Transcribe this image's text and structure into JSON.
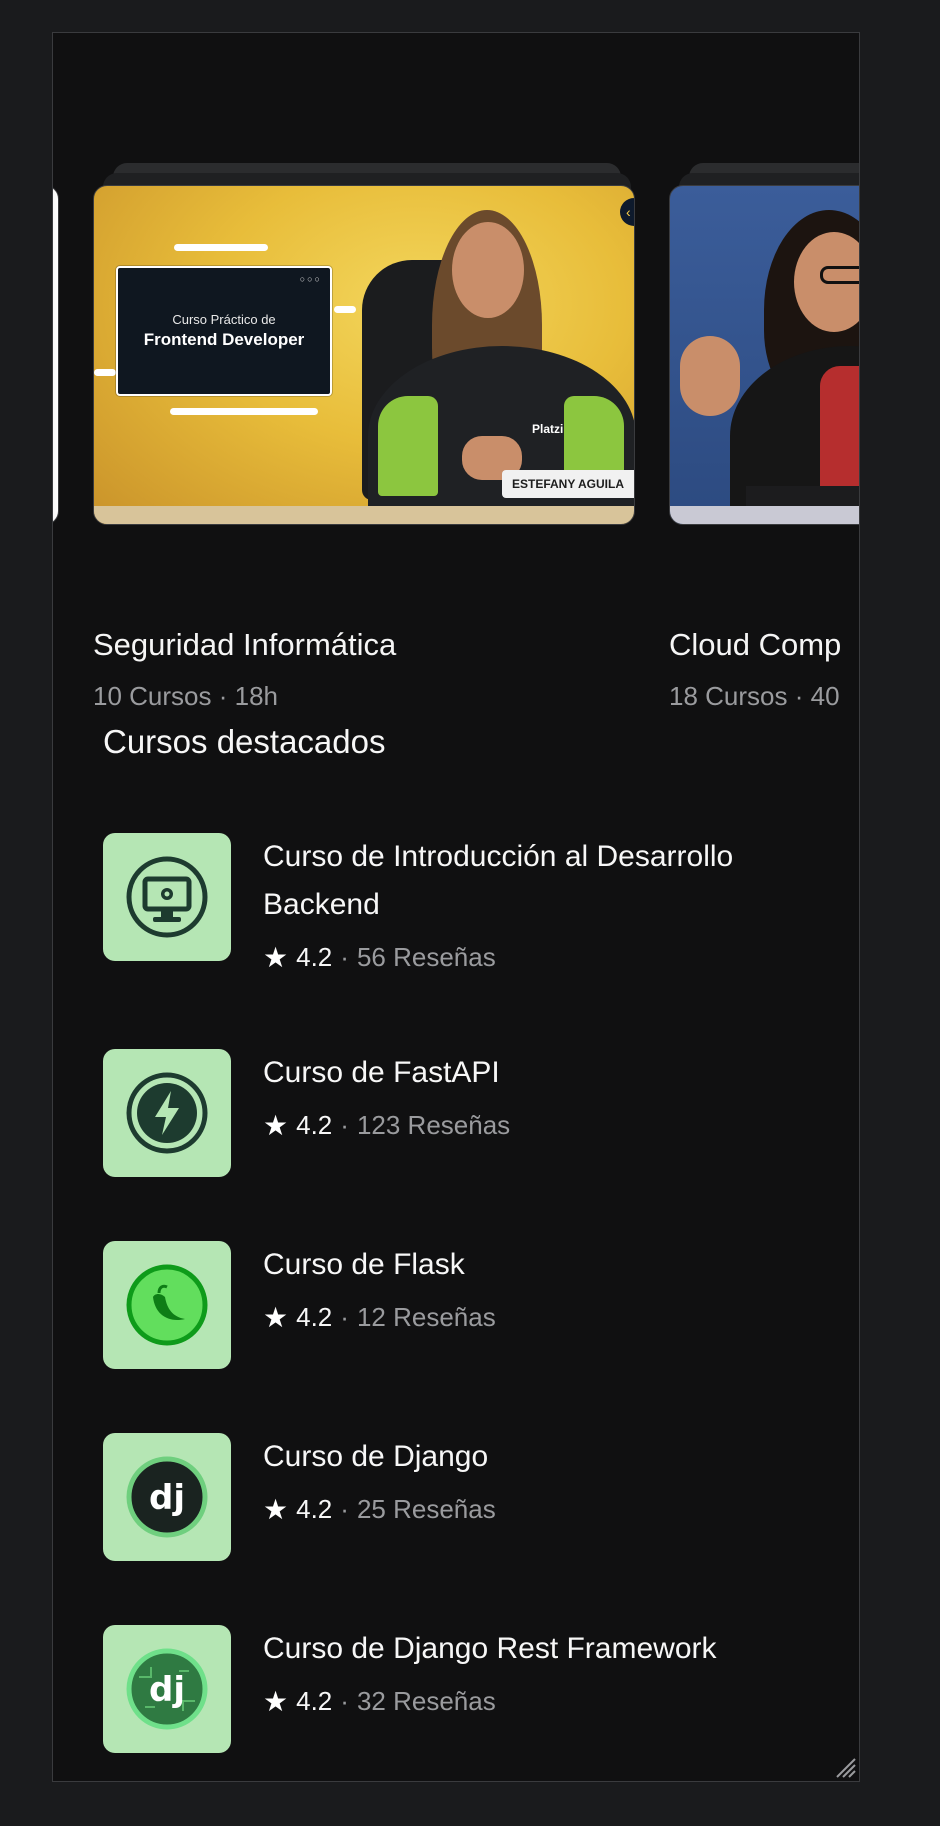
{
  "carousel": {
    "cards": [
      {
        "title": "Seguridad Informática",
        "meta": "10 Cursos · 18h",
        "thumb_small": "Curso Práctico de",
        "thumb_big": "Frontend Developer",
        "name_tag": "ESTEFANY AGUILA",
        "logo": "Platzi"
      },
      {
        "title": "Cloud Comp",
        "meta": "18 Cursos · 40"
      }
    ],
    "accent": "#e8bd3a"
  },
  "featured": {
    "title": "Cursos destacados",
    "icon_bg": "#b5e6b4",
    "courses": [
      {
        "title": "Curso de Introducción al Desarrollo Backend",
        "rating": "4.2",
        "reviews": "56 Reseñas",
        "icon": "backend-monitor-icon"
      },
      {
        "title": "Curso de FastAPI",
        "rating": "4.2",
        "reviews": "123 Reseñas",
        "icon": "fastapi-bolt-icon"
      },
      {
        "title": "Curso de Flask",
        "rating": "4.2",
        "reviews": "12 Reseñas",
        "icon": "flask-pepper-icon"
      },
      {
        "title": "Curso de Django",
        "rating": "4.2",
        "reviews": "25 Reseñas",
        "icon": "django-icon",
        "icon_text": "dj"
      },
      {
        "title": "Curso de Django Rest Framework",
        "rating": "4.2",
        "reviews": "32 Reseñas",
        "icon": "django-rest-icon",
        "icon_text": "dj"
      }
    ]
  },
  "separator": "·",
  "star": "★"
}
